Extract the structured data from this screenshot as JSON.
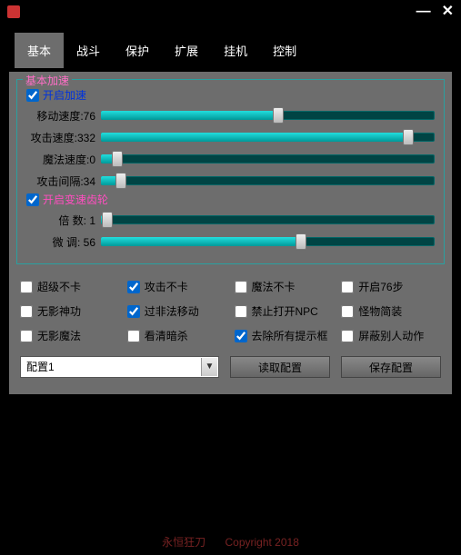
{
  "titlebar": {
    "icon": "app-icon",
    "minimize": "—",
    "close": "✕"
  },
  "tabs": {
    "items": [
      "基本",
      "战斗",
      "保护",
      "扩展",
      "挂机",
      "控制"
    ],
    "active": 0
  },
  "section1": {
    "legend": "基本加速",
    "enable_speed": {
      "label": "开启加速",
      "checked": true
    },
    "sliders": [
      {
        "label": "移动速度:76",
        "value": 76,
        "pct": 53
      },
      {
        "label": "攻击速度:332",
        "value": 332,
        "pct": 92
      },
      {
        "label": "魔法速度:0",
        "value": 0,
        "pct": 5
      },
      {
        "label": "攻击间隔:34",
        "value": 34,
        "pct": 6
      }
    ],
    "enable_gear": {
      "label": "开启变速齿轮",
      "checked": true
    },
    "sliders2": [
      {
        "label": "倍   数:  1",
        "value": 1,
        "pct": 2
      },
      {
        "label": "微   调:  56",
        "value": 56,
        "pct": 60
      }
    ]
  },
  "checkgrid": [
    {
      "label": "超级不卡",
      "checked": false
    },
    {
      "label": "攻击不卡",
      "checked": true
    },
    {
      "label": "魔法不卡",
      "checked": false
    },
    {
      "label": "开启76步",
      "checked": false
    },
    {
      "label": "无影神功",
      "checked": false
    },
    {
      "label": "过非法移动",
      "checked": true
    },
    {
      "label": "禁止打开NPC",
      "checked": false
    },
    {
      "label": "怪物简装",
      "checked": false
    },
    {
      "label": "无影魔法",
      "checked": false
    },
    {
      "label": "看清暗杀",
      "checked": false
    },
    {
      "label": "去除所有提示框",
      "checked": true
    },
    {
      "label": "屏蔽别人动作",
      "checked": false
    }
  ],
  "bottom": {
    "combo": {
      "value": "配置1"
    },
    "read_btn": "读取配置",
    "save_btn": "保存配置"
  },
  "footer": {
    "brand": "永恒狂刀",
    "copy": "Copyright 2018"
  }
}
